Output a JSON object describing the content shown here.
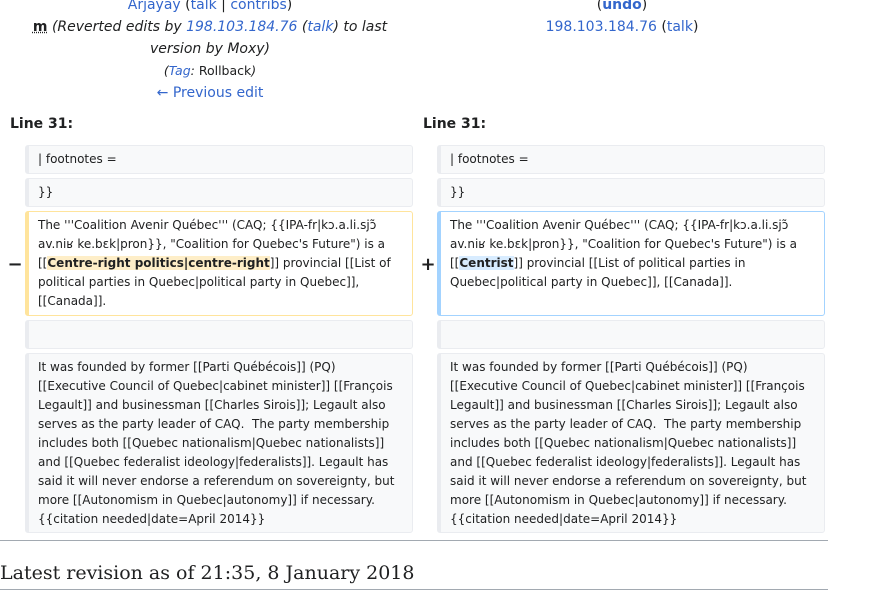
{
  "left_header": {
    "user": "Arjayay",
    "talk": "talk",
    "separator": "|",
    "contribs": "contribs",
    "minor": "m",
    "summary_pre": "(Reverted edits by ",
    "ip": "198.103.184.76",
    "ip_talk": "talk",
    "summary_post": ") to last",
    "summary_line2": "version by Moxy)",
    "tag_word": "Tag",
    "tag_value": "Rollback",
    "previous_edit": "← Previous edit"
  },
  "right_header": {
    "undo": "undo",
    "ip": "198.103.184.76",
    "talk": "talk"
  },
  "line_left": "Line 31:",
  "line_right": "Line 31:",
  "markers": {
    "removed": "−",
    "added": "+"
  },
  "rows": {
    "footnotes": "| footnotes =",
    "close_braces": "}}",
    "paragraph_prefix": "The '''Coalition Avenir Québec''' (CAQ; {{IPA-fr|kɔ.a.li.sjɔ̃ av.niʁ ke.bɛk|pron}}, \"Coalition for Quebec's Future\") is a [[",
    "removed_highlight": "Centre-right politics|centre-right",
    "added_highlight": "Centrist",
    "paragraph_suffix": "]] provincial [[List of political parties in Quebec|political party in Quebec]], [[Canada]].",
    "founded": "It was founded by former [[Parti Québécois]] (PQ) [[Executive Council of Quebec|cabinet minister]] [[François Legault]] and businessman [[Charles Sirois]]; Legault also serves as the party leader of CAQ.  The party membership includes both [[Quebec nationalism|Quebec nationalists]] and [[Quebec federalist ideology|federalists]]. Legault has said it will never endorse a referendum on sovereignty, but more [[Autonomism in Quebec|autonomy]] if necessary.{{citation needed|date=April 2014}}"
  },
  "latest_revision": "Latest revision as of 21:35, 8 January 2018"
}
